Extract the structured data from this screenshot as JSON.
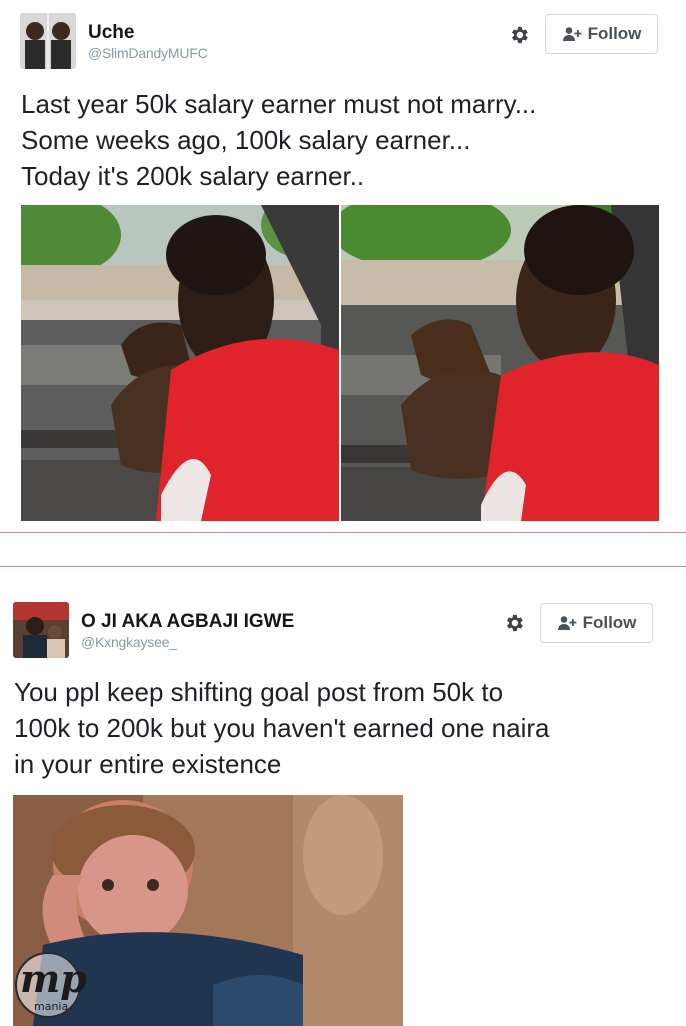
{
  "tweets": [
    {
      "user": {
        "name": "Uche",
        "handle": "@SlimDandyMUFC"
      },
      "follow_label": "Follow",
      "text_lines": [
        "Last year 50k salary earner must not marry...",
        "Some weeks ago, 100k salary earner...",
        "Today it's 200k salary earner.."
      ],
      "media_count": 2
    },
    {
      "user": {
        "name": "O JI AKA AGBAJI IGWE",
        "handle": "@Kxngkaysee_"
      },
      "follow_label": "Follow",
      "text_lines": [
        "You ppl keep shifting goal post from 50k to",
        "100k to 200k but you haven't earned one naira",
        "in your entire existence"
      ],
      "media_count": 1
    }
  ],
  "watermark": {
    "logo_text": "mp",
    "sub_text": "mania"
  },
  "colors": {
    "divider": "#c98a86",
    "text": "#1d2024",
    "handle": "#8899a6",
    "shirt_red": "#e1232c"
  }
}
